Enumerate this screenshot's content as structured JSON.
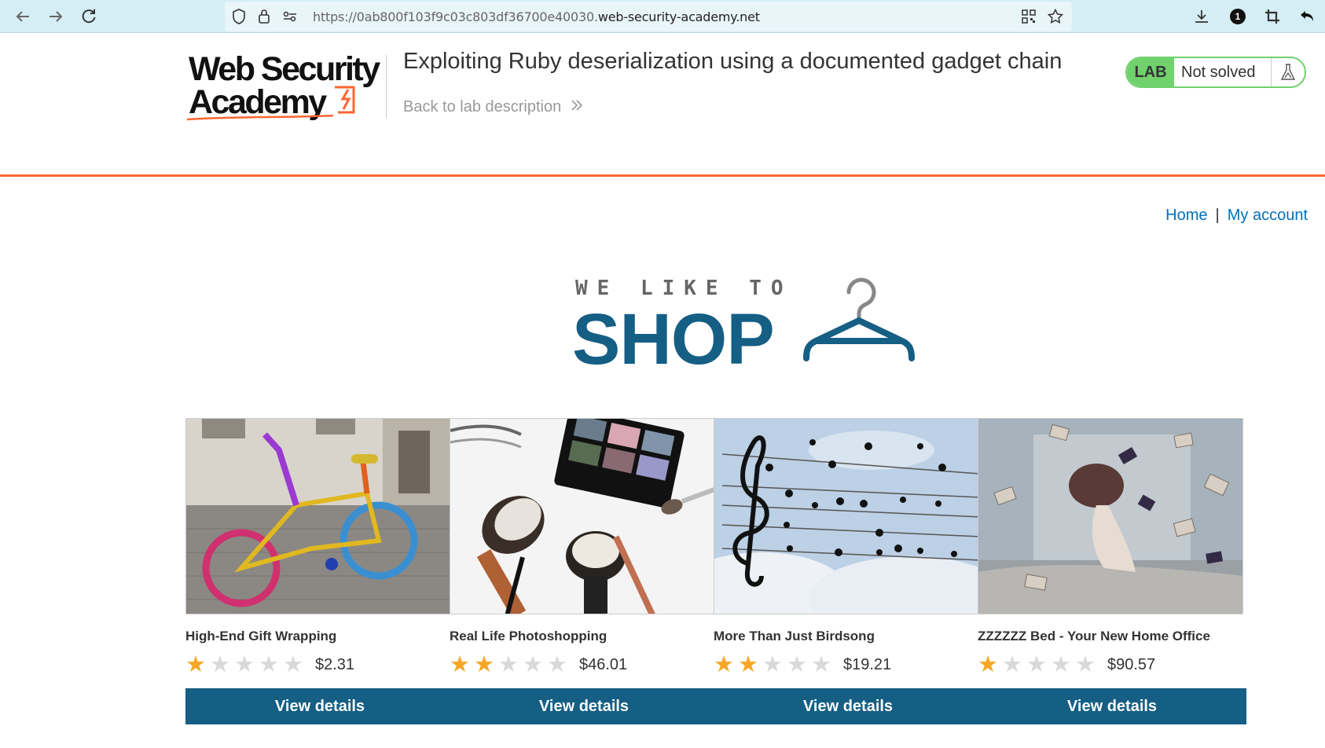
{
  "browser": {
    "url_host_prefix": "https://0ab800f103f9c03c803df36700e40030.",
    "url_domain": "web-security-academy.net",
    "profile_badge": "1"
  },
  "header": {
    "logo_line1": "Web Security",
    "logo_line2": "Academy",
    "lab_title": "Exploiting Ruby deserialization using a documented gadget chain",
    "back_link": "Back to lab description",
    "badge_label": "LAB",
    "badge_status": "Not solved"
  },
  "nav": {
    "home": "Home",
    "separator": "|",
    "account": "My account"
  },
  "hero": {
    "small": "WE LIKE TO",
    "big": "SHOP"
  },
  "colors": {
    "accent_orange": "#ff6633",
    "brand_blue": "#155e84",
    "lab_green": "#70d16d",
    "star_gold": "#f5a623",
    "link_blue": "#0071bc"
  },
  "products": [
    {
      "name": "High-End Gift Wrapping",
      "rating": 1,
      "price": "$2.31",
      "button": "View details"
    },
    {
      "name": "Real Life Photoshopping",
      "rating": 2,
      "price": "$46.01",
      "button": "View details"
    },
    {
      "name": "More Than Just Birdsong",
      "rating": 2,
      "price": "$19.21",
      "button": "View details"
    },
    {
      "name": "ZZZZZZ Bed - Your New Home Office",
      "rating": 1,
      "price": "$90.57",
      "button": "View details"
    }
  ]
}
